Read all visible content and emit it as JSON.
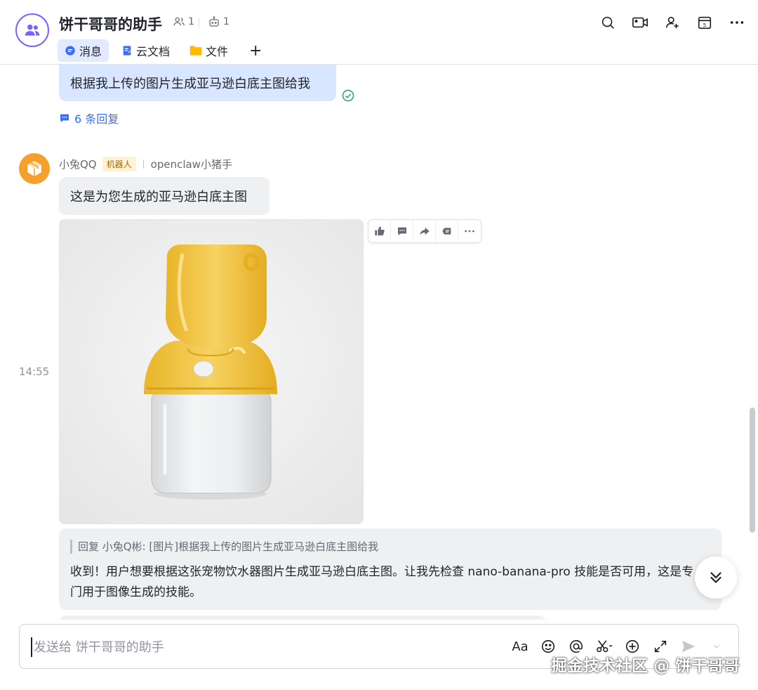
{
  "header": {
    "title": "饼干哥哥的助手",
    "member_count": "1",
    "bot_count": "1",
    "tabs": [
      {
        "label": "消息"
      },
      {
        "label": "云文档"
      },
      {
        "label": "文件"
      }
    ],
    "add_tab": "+"
  },
  "messages": {
    "user_message": "根据我上传的图片生成亚马逊白底主图给我",
    "reply_count": "6 条回复",
    "bot": {
      "name": "小兔QQ",
      "badge": "机器人",
      "app": "openclaw小猪手"
    },
    "bot_message": "这是为您生成的亚马逊白底主图",
    "time": "14:55",
    "reply": {
      "quote": "回复 小兔Q彬: [图片]根据我上传的图片生成亚马逊白底主图给我",
      "text": "收到！用户想要根据这张宠物饮水器图片生成亚马逊白底主图。让我先检查 nano-banana-pro 技能是否可用，这是专门用于图像生成的技能。"
    }
  },
  "input": {
    "placeholder": "发送给 饼干哥哥的助手",
    "font_tool": "Aa"
  },
  "watermark": "掘金技术社区 @ 饼干哥哥",
  "colors": {
    "accent": "#3370ff",
    "avatar_ring": "#7b61ff",
    "bot_avatar": "#f5a02a",
    "user_bubble": "#d9e6ff",
    "bot_bubble": "#eff0f1"
  }
}
